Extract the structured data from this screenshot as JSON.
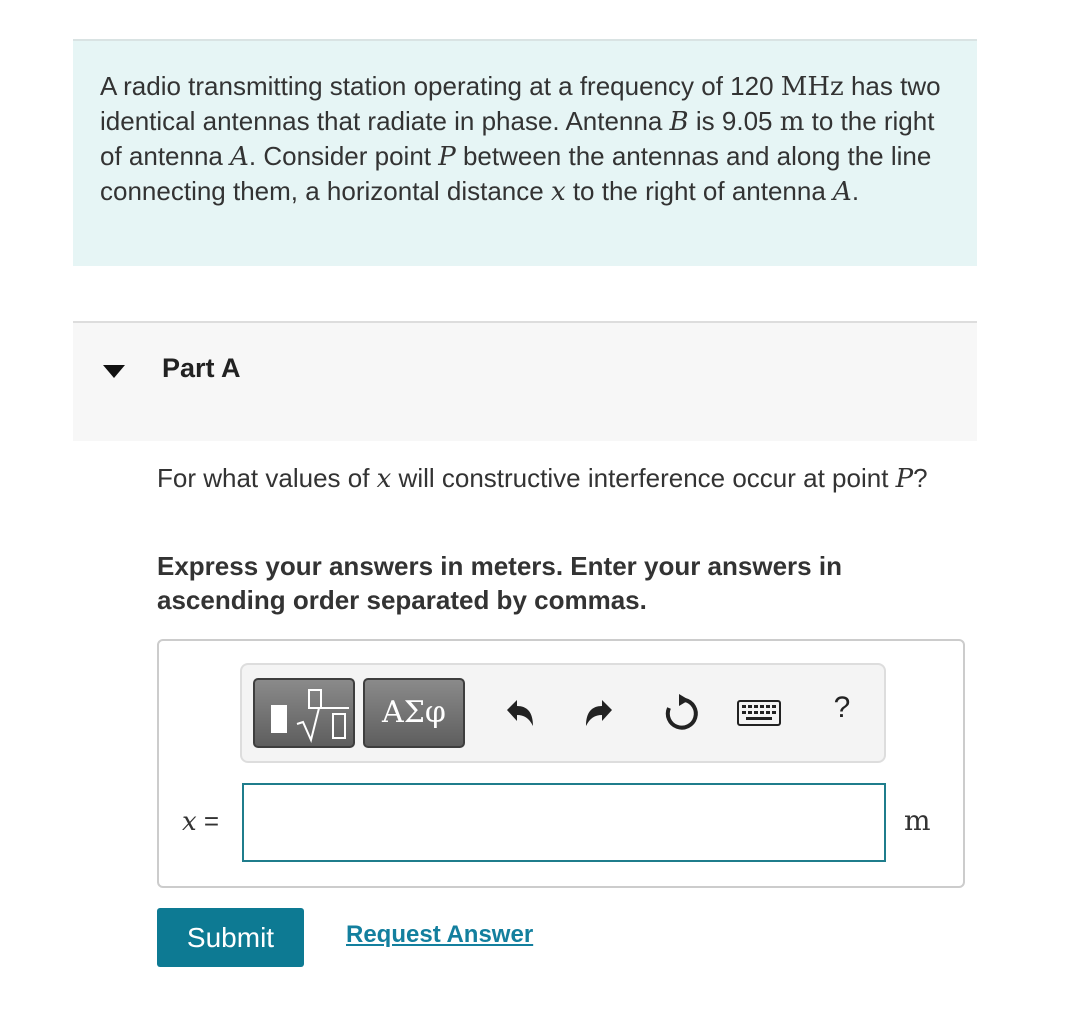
{
  "intro": {
    "t1": "A radio transmitting station operating at a frequency of 120 ",
    "freq_unit": "MHz",
    "t2": " has two identical antennas that radiate in phase. Antenna ",
    "b": "B",
    "t3": " is 9.05 ",
    "m": "m",
    "t4": " to the right of antenna ",
    "a1": "A",
    "t5": ". Consider point ",
    "p": "P",
    "t6": " between the antennas and along the line connecting them, a horizontal distance ",
    "x": "x",
    "t7": " to the right of antenna ",
    "a2": "A",
    "t8": "."
  },
  "part": {
    "title": "Part A"
  },
  "question": {
    "t1": "For what values of ",
    "x": "x",
    "t2": " will constructive interference occur at point ",
    "p": "P",
    "t3": "?"
  },
  "instruction": "Express your answers in meters. Enter your answers in ascending order separated by commas.",
  "toolbar": {
    "symbols_label": "ΑΣφ",
    "help_label": "?",
    "icons": [
      "templates-icon",
      "undo-icon",
      "redo-icon",
      "reset-icon",
      "keyboard-icon",
      "help-icon"
    ]
  },
  "answer": {
    "variable": "x",
    "equals": " =",
    "value": "",
    "unit": "m"
  },
  "buttons": {
    "submit": "Submit",
    "request_answer": "Request Answer"
  },
  "colors": {
    "accent": "#0d7a93",
    "link": "#137f9e",
    "intro_bg": "#e6f5f5",
    "input_border": "#1f7d8c"
  }
}
